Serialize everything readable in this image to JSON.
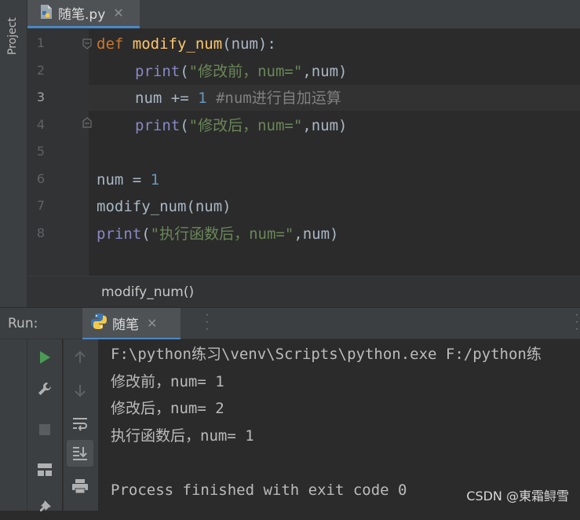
{
  "sidebar": {
    "project_label": "Project"
  },
  "tab": {
    "title": "随笔.py",
    "close": "✕"
  },
  "editor": {
    "line_numbers": [
      "1",
      "2",
      "3",
      "4",
      "5",
      "6",
      "7",
      "8"
    ],
    "current_line": 3,
    "lines": [
      {
        "def": "def",
        "name": "modify_num",
        "rest": "(num):"
      },
      {
        "fn": "print",
        "open": "(",
        "str": "\"修改前，num=\"",
        "tail": ",num)"
      },
      {
        "var": "num ",
        "op": "+= ",
        "num": "1",
        "comment": " #num进行自加运算"
      },
      {
        "fn": "print",
        "open": "(",
        "str": "\"修改后，num=\"",
        "tail": ",num)"
      },
      {},
      {
        "var": "num ",
        "op": "= ",
        "num": "1"
      },
      {
        "text": "modify_num(num)"
      },
      {
        "fn": "print",
        "open": "(",
        "str": "\"执行函数后，num=\"",
        "tail": ",num)"
      }
    ]
  },
  "breadcrumb": {
    "text": "modify_num()"
  },
  "run": {
    "label": "Run:",
    "tab_title": "随笔",
    "close": "✕"
  },
  "console": {
    "lines": [
      "F:\\python练习\\venv\\Scripts\\python.exe F:/python练",
      "修改前，num= 1",
      "修改后，num= 2",
      "执行函数后，num= 1",
      "",
      "Process finished with exit code 0"
    ]
  },
  "watermark": "CSDN @東霜鲟雪",
  "colors": {
    "accent": "#4a88c7",
    "run_green": "#499c54",
    "keyword": "#cc7832",
    "function_def": "#ffc66d",
    "builtin": "#8888c6",
    "string": "#6a8759",
    "number": "#6897bb",
    "comment": "#808080"
  },
  "icons": {
    "tab_file": "python-file-icon",
    "run_tab": "python-icon",
    "run_tools": [
      "run-icon",
      "wrench-icon",
      "stop-icon",
      "layout-icon",
      "pin-icon"
    ],
    "console_tools": [
      "up-arrow-icon",
      "down-arrow-icon",
      "soft-wrap-icon",
      "scroll-to-end-icon",
      "print-icon"
    ]
  }
}
